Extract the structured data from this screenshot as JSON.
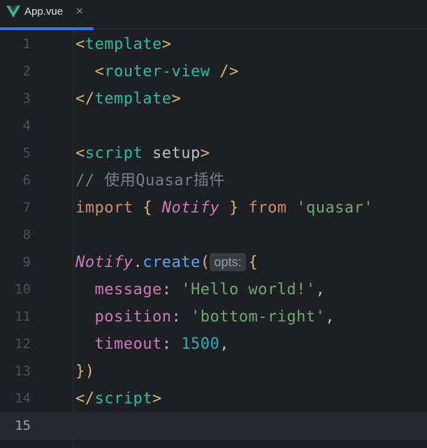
{
  "tab": {
    "label": "App.vue",
    "close": "×",
    "icon": "vue-icon"
  },
  "colors": {
    "accent": "#3574f0",
    "background": "#1e1f22",
    "tag": "#2fbaa3",
    "keyword": "#cf8e6d",
    "string": "#6aab73",
    "number": "#2aacb8",
    "property": "#c77dbb",
    "function": "#56a8f5"
  },
  "editor": {
    "current_line": 15,
    "lines": [
      {
        "n": "1",
        "tokens": [
          [
            "tag-br",
            "<"
          ],
          [
            "tag",
            "template"
          ],
          [
            "tag-br",
            ">"
          ]
        ]
      },
      {
        "n": "2",
        "tokens": [
          [
            "plain",
            "  "
          ],
          [
            "tag-br",
            "<"
          ],
          [
            "tag",
            "router-view"
          ],
          [
            "plain",
            " "
          ],
          [
            "tag-br",
            "/>"
          ]
        ]
      },
      {
        "n": "3",
        "tokens": [
          [
            "tag-br",
            "</"
          ],
          [
            "tag",
            "template"
          ],
          [
            "tag-br",
            ">"
          ]
        ]
      },
      {
        "n": "4",
        "tokens": []
      },
      {
        "n": "5",
        "tokens": [
          [
            "tag-br",
            "<"
          ],
          [
            "tag",
            "script"
          ],
          [
            "plain",
            " "
          ],
          [
            "attr",
            "setup"
          ],
          [
            "tag-br",
            ">"
          ]
        ]
      },
      {
        "n": "6",
        "tokens": [
          [
            "cmt",
            "// 使用Quasar插件"
          ]
        ]
      },
      {
        "n": "7",
        "tokens": [
          [
            "kw",
            "import"
          ],
          [
            "plain",
            " "
          ],
          [
            "brace",
            "{"
          ],
          [
            "plain",
            " "
          ],
          [
            "cls",
            "Notify"
          ],
          [
            "plain",
            " "
          ],
          [
            "brace",
            "}"
          ],
          [
            "plain",
            " "
          ],
          [
            "kw",
            "from"
          ],
          [
            "plain",
            " "
          ],
          [
            "str",
            "'quasar'"
          ]
        ]
      },
      {
        "n": "8",
        "tokens": []
      },
      {
        "n": "9",
        "tokens": [
          [
            "cls",
            "Notify"
          ],
          [
            "plain",
            "."
          ],
          [
            "fn",
            "create"
          ],
          [
            "brace",
            "("
          ],
          [
            "hint",
            "opts:"
          ],
          [
            "brace",
            "{"
          ]
        ]
      },
      {
        "n": "10",
        "tokens": [
          [
            "plain",
            "  "
          ],
          [
            "prop",
            "message"
          ],
          [
            "plain",
            ": "
          ],
          [
            "str",
            "'Hello world!'"
          ],
          [
            "plain",
            ","
          ]
        ]
      },
      {
        "n": "11",
        "tokens": [
          [
            "plain",
            "  "
          ],
          [
            "prop",
            "position"
          ],
          [
            "plain",
            ": "
          ],
          [
            "str",
            "'bottom-right'"
          ],
          [
            "plain",
            ","
          ]
        ]
      },
      {
        "n": "12",
        "tokens": [
          [
            "plain",
            "  "
          ],
          [
            "prop",
            "timeout"
          ],
          [
            "plain",
            ": "
          ],
          [
            "num",
            "1500"
          ],
          [
            "plain",
            ","
          ]
        ]
      },
      {
        "n": "13",
        "tokens": [
          [
            "brace",
            "}"
          ],
          [
            "brace",
            ")"
          ]
        ]
      },
      {
        "n": "14",
        "tokens": [
          [
            "tag-br",
            "</"
          ],
          [
            "tag",
            "script"
          ],
          [
            "tag-br",
            ">"
          ]
        ]
      },
      {
        "n": "15",
        "tokens": []
      }
    ]
  }
}
